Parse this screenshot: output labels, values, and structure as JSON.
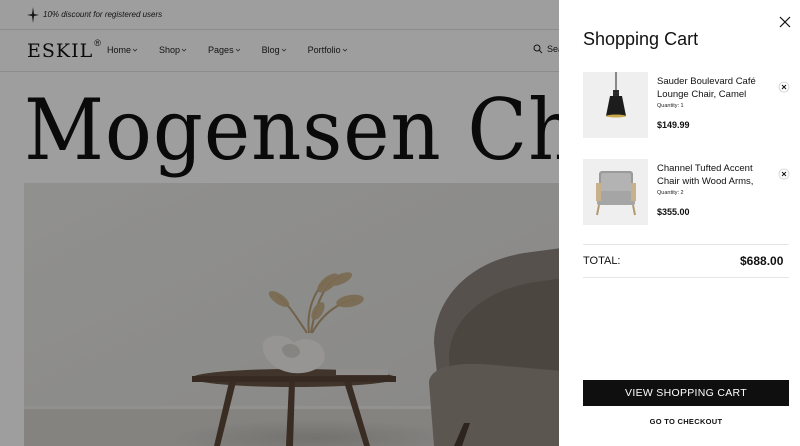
{
  "topbar": {
    "promo_text": "10% discount for registered users",
    "icon": "sparkle-icon"
  },
  "header": {
    "logo_text": "ESKIL",
    "logo_mark": "®",
    "menu": [
      {
        "label": "Home"
      },
      {
        "label": "Shop"
      },
      {
        "label": "Pages"
      },
      {
        "label": "Blog"
      },
      {
        "label": "Portfolio"
      }
    ],
    "search_label": "Sea"
  },
  "hero": {
    "title": "Mogensen Chair"
  },
  "cart": {
    "title": "Shopping Cart",
    "items": [
      {
        "name": "Sauder Boulevard Café Lounge Chair, Camel",
        "quantity_text": "Quantity: 1",
        "price": "$149.99",
        "thumb": "pendant-lamp"
      },
      {
        "name": "Channel Tufted Accent Chair with Wood Arms,",
        "quantity_text": "Quantity: 2",
        "price": "$355.00",
        "thumb": "grey-accent-chair"
      }
    ],
    "total_label": "TOTAL:",
    "total_value": "$688.00",
    "view_cart_label": "VIEW SHOPPING CART",
    "checkout_label": "GO TO CHECKOUT"
  },
  "colors": {
    "overlay": "#000000",
    "button_bg": "#0f0f0f",
    "thumb_bg": "#efefef"
  }
}
